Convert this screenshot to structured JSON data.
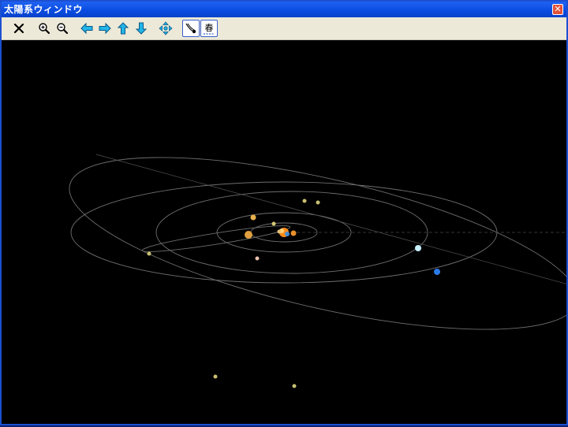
{
  "window": {
    "title": "太陽系ウィンドウ",
    "close_symbol": "✕"
  },
  "toolbar": {
    "buttons": [
      {
        "id": "close",
        "icon": "x-icon"
      },
      {
        "id": "zoom_in",
        "icon": "zoom-in-icon"
      },
      {
        "id": "zoom_out",
        "icon": "zoom-out-icon"
      },
      {
        "id": "rotate_left",
        "icon": "arrow-left-icon"
      },
      {
        "id": "rotate_right",
        "icon": "arrow-right-icon"
      },
      {
        "id": "tilt_up",
        "icon": "arrow-up-icon"
      },
      {
        "id": "tilt_down",
        "icon": "arrow-down-icon"
      },
      {
        "id": "reset_view",
        "icon": "move-all-directions-icon"
      },
      {
        "id": "orbit_toggle",
        "icon": "comet-icon",
        "active": true
      },
      {
        "id": "vernal_equinox",
        "icon": "vernal-equinox-icon",
        "label": "春",
        "active": true
      }
    ]
  },
  "colors": {
    "viewport_bg": "#000000",
    "orbit_line": "#6e6e6e",
    "titlebar": "#0a4be0",
    "toolbar_bg": "#ece9d8",
    "toolbar_arrow": "#22b5e8"
  }
}
